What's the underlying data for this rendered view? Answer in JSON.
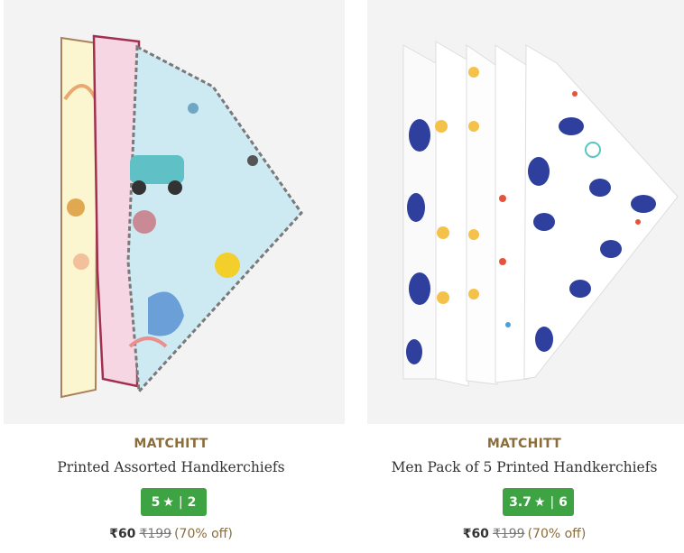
{
  "colors": {
    "brand": "#8a6d3b",
    "rating_badge": "#3ea443",
    "discount": "#8a6d3b"
  },
  "products": [
    {
      "brand": "MATCHITT",
      "title": "Printed Assorted Handkerchiefs",
      "rating": "5",
      "star": "★",
      "separator": "|",
      "review_count": "2",
      "price": "₹60",
      "mrp": "₹199",
      "discount": "(70% off)"
    },
    {
      "brand": "MATCHITT",
      "title": "Men Pack of 5 Printed Handkerchiefs",
      "rating": "3.7",
      "star": "★",
      "separator": "|",
      "review_count": "6",
      "price": "₹60",
      "mrp": "₹199",
      "discount": "(70% off)"
    }
  ]
}
